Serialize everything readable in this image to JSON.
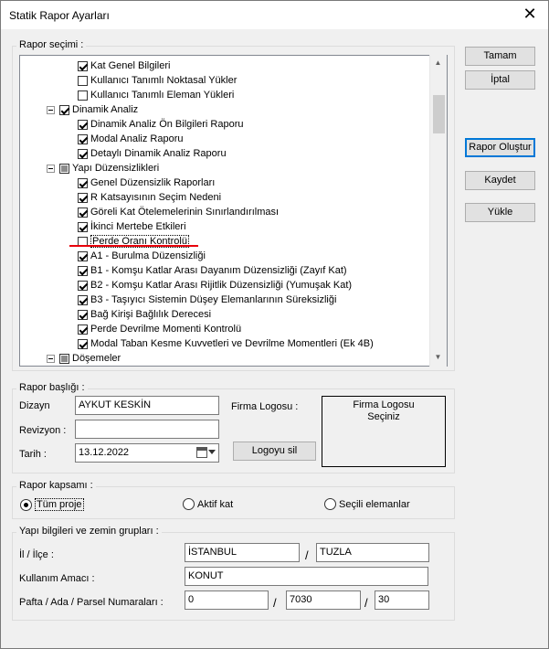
{
  "window": {
    "title": "Statik Rapor Ayarları",
    "close_glyph": "✕"
  },
  "rapor_secimi": {
    "label": "Rapor seçimi :",
    "tree": [
      {
        "indent": 1,
        "check": "checked",
        "expander": false,
        "text": "Kat Genel Bilgileri"
      },
      {
        "indent": 1,
        "check": "unchecked",
        "expander": false,
        "text": "Kullanıcı Tanımlı Noktasal Yükler"
      },
      {
        "indent": 1,
        "check": "unchecked",
        "expander": false,
        "text": "Kullanıcı Tanımlı Eleman Yükleri"
      },
      {
        "indent": 0,
        "check": "checked",
        "expander": true,
        "text": "Dinamik Analiz"
      },
      {
        "indent": 1,
        "check": "checked",
        "expander": false,
        "text": "Dinamik Analiz Ön Bilgileri Raporu"
      },
      {
        "indent": 1,
        "check": "checked",
        "expander": false,
        "text": "Modal Analiz Raporu"
      },
      {
        "indent": 1,
        "check": "checked",
        "expander": false,
        "text": "Detaylı Dinamik Analiz Raporu"
      },
      {
        "indent": 0,
        "check": "partial",
        "expander": true,
        "text": "Yapı Düzensizlikleri"
      },
      {
        "indent": 1,
        "check": "checked",
        "expander": false,
        "text": "Genel Düzensizlik Raporları"
      },
      {
        "indent": 1,
        "check": "checked",
        "expander": false,
        "text": "R Katsayısının Seçim Nedeni"
      },
      {
        "indent": 1,
        "check": "checked",
        "expander": false,
        "text": "Göreli Kat Ötelemelerinin Sınırlandırılması"
      },
      {
        "indent": 1,
        "check": "checked",
        "expander": false,
        "text": "İkinci Mertebe Etkileri"
      },
      {
        "indent": 1,
        "check": "unchecked",
        "expander": false,
        "text": "Perde Oranı Kontrolü",
        "selected": true
      },
      {
        "indent": 1,
        "check": "checked",
        "expander": false,
        "text": "A1 - Burulma Düzensizliği"
      },
      {
        "indent": 1,
        "check": "checked",
        "expander": false,
        "text": "B1 - Komşu Katlar Arası Dayanım Düzensizliği (Zayıf Kat)"
      },
      {
        "indent": 1,
        "check": "checked",
        "expander": false,
        "text": "B2 - Komşu Katlar Arası Rijitlik Düzensizliği (Yumuşak Kat)"
      },
      {
        "indent": 1,
        "check": "checked",
        "expander": false,
        "text": "B3 - Taşıyıcı Sistemin Düşey Elemanlarının Süreksizliği"
      },
      {
        "indent": 1,
        "check": "checked",
        "expander": false,
        "text": "Bağ Kirişi Bağlılık Derecesi"
      },
      {
        "indent": 1,
        "check": "checked",
        "expander": false,
        "text": "Perde Devrilme Momenti Kontrolü"
      },
      {
        "indent": 1,
        "check": "checked",
        "expander": false,
        "text": "Modal Taban Kesme Kuvvetleri ve Devrilme Momentleri  (Ek 4B)"
      },
      {
        "indent": 0,
        "check": "partial",
        "expander": true,
        "text": "Döşemeler"
      }
    ]
  },
  "buttons": {
    "tamam": "Tamam",
    "iptal": "İptal",
    "rapor_olustur": "Rapor Oluştur",
    "kaydet": "Kaydet",
    "yukle": "Yükle",
    "logoyu_sil": "Logoyu sil"
  },
  "rapor_basligi": {
    "label": "Rapor başlığı :",
    "dizayn_label": "Dizayn",
    "dizayn_value": "AYKUT KESKİN",
    "revizyon_label": "Revizyon :",
    "revizyon_value": "",
    "tarih_label": "Tarih :",
    "tarih_value": "13.12.2022",
    "firma_logosu_label": "Firma Logosu :",
    "logo_box_line1": "Firma Logosu",
    "logo_box_line2": "Seçiniz"
  },
  "rapor_kapsami": {
    "label": "Rapor kapsamı :",
    "options": [
      {
        "text": "Tüm proje",
        "selected": true
      },
      {
        "text": "Aktif kat",
        "selected": false
      },
      {
        "text": "Seçili elemanlar",
        "selected": false
      }
    ]
  },
  "yapi_bilgileri": {
    "label": "Yapı bilgileri ve zemin grupları :",
    "il_ilce_label": "İl / İlçe :",
    "il_value": "İSTANBUL",
    "ilce_value": "TUZLA",
    "kullanim_label": "Kullanım Amacı :",
    "kullanim_value": "KONUT",
    "pafta_label": "Pafta / Ada / Parsel Numaraları :",
    "pafta_value": "0",
    "ada_value": "7030",
    "parsel_value": "30",
    "separator": "/"
  },
  "icons": {
    "scroll_up": "up-arrow-icon",
    "scroll_down": "down-arrow-icon",
    "calendar": "calendar-icon"
  }
}
